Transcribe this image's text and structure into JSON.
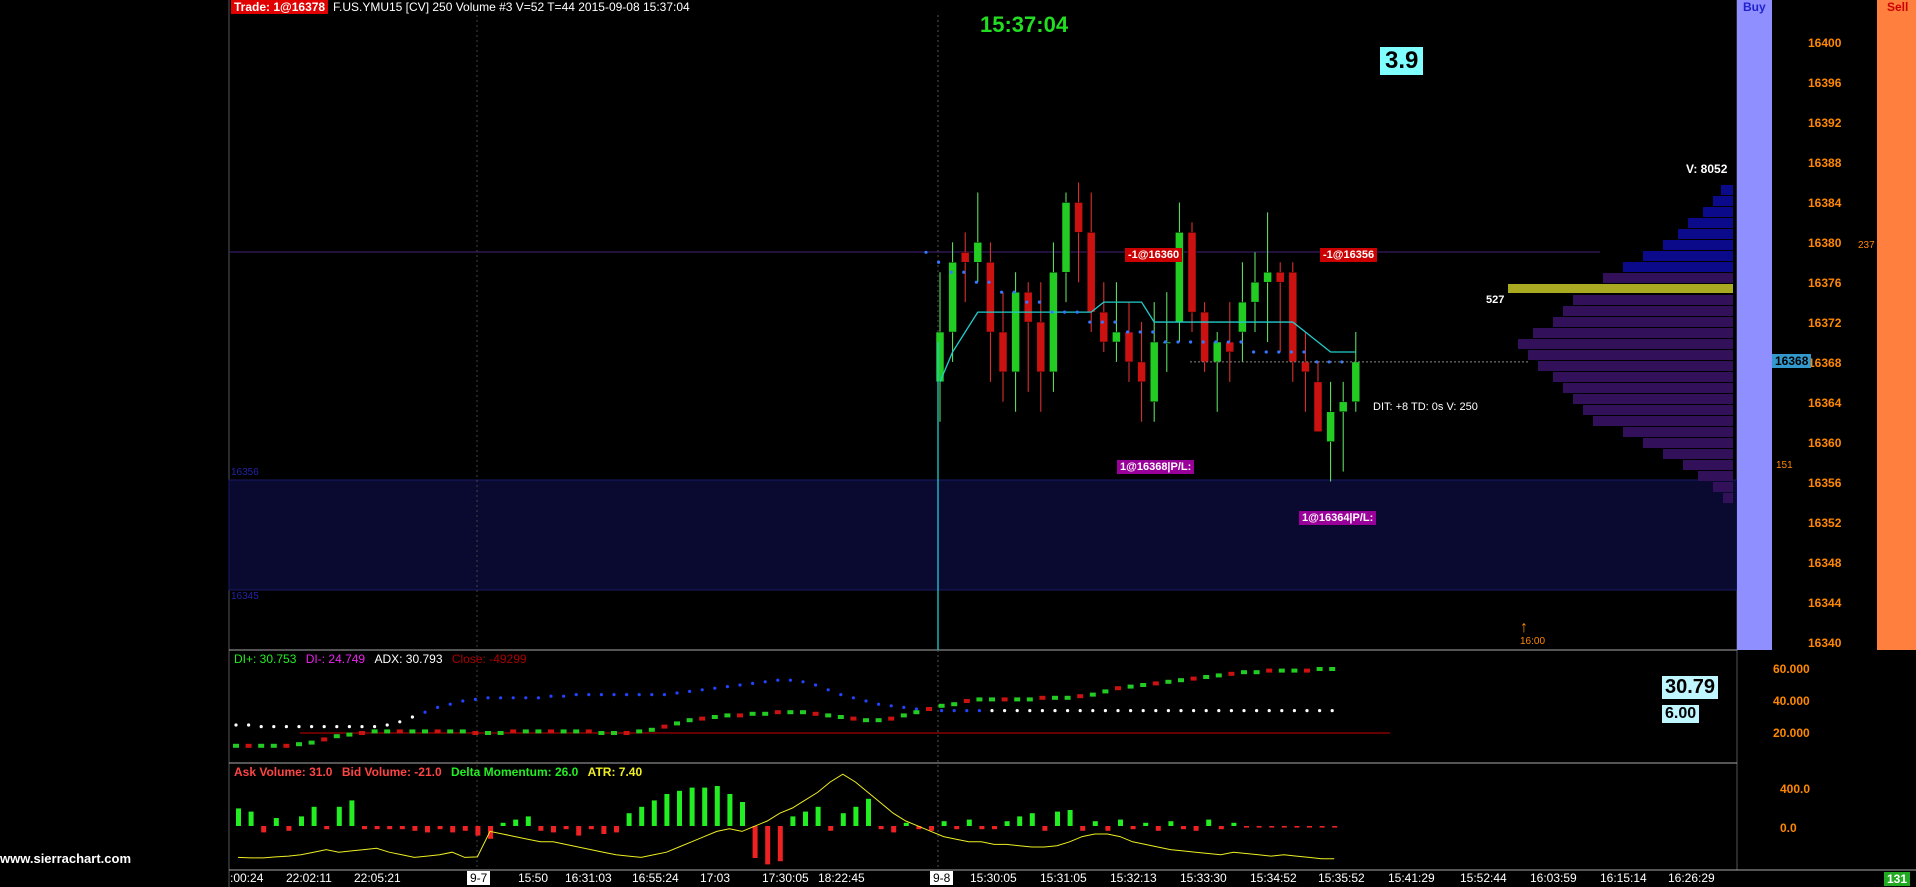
{
  "header": {
    "trade_badge": "Trade: 1@16378",
    "title": "F.US.YMU15 [CV]  250 Volume  #3 V=52 T=44 2015-09-08 15:37:04"
  },
  "clock": "15:37:04",
  "countdown_box": "3.9",
  "buy_label": "Buy",
  "sell_label": "Sell",
  "watermark": "www.sierrachart.com",
  "price_axis": [
    "16400",
    "16396",
    "16392",
    "16388",
    "16384",
    "16380",
    "16376",
    "16372",
    "16368",
    "16364",
    "16360",
    "16356",
    "16352",
    "16348",
    "16344",
    "16340"
  ],
  "current_price": "16368",
  "volume_profile": {
    "total_label": "V: 8052",
    "poc_volume": "527"
  },
  "orders": {
    "sell_1": "-1@16360",
    "sell_2": "-1@16356",
    "fill_1": "1@16368|P/L:",
    "fill_2": "1@16364|P/L:"
  },
  "bar_info": "DIT: +8  TD: 0s  V: 250",
  "zone_labels": {
    "upper": "16356",
    "lower": "16345"
  },
  "session_marker": "16:00",
  "side_numbers": {
    "top": "237",
    "bottom": "151"
  },
  "dmi_panel": {
    "di_plus": "DI+: 30.753",
    "di_minus": "DI-: 24.749",
    "adx": "ADX: 30.793",
    "close": "Close: -49299",
    "value_box_1": "30.79",
    "value_box_2": "6.00",
    "axis": [
      "60.000",
      "40.000",
      "20.000"
    ]
  },
  "volume_panel": {
    "ask": "Ask Volume: 31.0",
    "bid": "Bid Volume: -21.0",
    "delta": "Delta Momentum: 26.0",
    "atr": "ATR: 7.40",
    "axis": [
      "400.0",
      "0.0"
    ]
  },
  "time_axis": [
    {
      "label": ":00:24",
      "hl": false
    },
    {
      "label": "22:02:11",
      "hl": false
    },
    {
      "label": "22:05:21",
      "hl": false
    },
    {
      "label": "9-7",
      "hl": true
    },
    {
      "label": "15:50",
      "hl": false
    },
    {
      "label": "16:31:03",
      "hl": false
    },
    {
      "label": "16:55:24",
      "hl": false
    },
    {
      "label": "17:03",
      "hl": false
    },
    {
      "label": "17:30:05",
      "hl": false
    },
    {
      "label": "18:22:45",
      "hl": false
    },
    {
      "label": "9-8",
      "hl": true
    },
    {
      "label": "15:30:05",
      "hl": false
    },
    {
      "label": "15:31:05",
      "hl": false
    },
    {
      "label": "15:32:13",
      "hl": false
    },
    {
      "label": "15:33:30",
      "hl": false
    },
    {
      "label": "15:34:52",
      "hl": false
    },
    {
      "label": "15:35:52",
      "hl": false
    },
    {
      "label": "15:41:29",
      "hl": false
    },
    {
      "label": "15:52:44",
      "hl": false
    },
    {
      "label": "16:03:59",
      "hl": false
    },
    {
      "label": "16:15:14",
      "hl": false
    },
    {
      "label": "16:26:29",
      "hl": false
    }
  ],
  "corner_value": "131",
  "candles": [
    {
      "o": 16366,
      "h": 16377,
      "l": 16362,
      "c": 16371
    },
    {
      "o": 16371,
      "h": 16380,
      "l": 16368,
      "c": 16378
    },
    {
      "o": 16379,
      "h": 16381,
      "l": 16374,
      "c": 16378
    },
    {
      "o": 16378,
      "h": 16385,
      "l": 16376,
      "c": 16380
    },
    {
      "o": 16378,
      "h": 16380,
      "l": 16366,
      "c": 16371
    },
    {
      "o": 16371,
      "h": 16375,
      "l": 16364,
      "c": 16367
    },
    {
      "o": 16367,
      "h": 16377,
      "l": 16363,
      "c": 16375
    },
    {
      "o": 16375,
      "h": 16376,
      "l": 16365,
      "c": 16372
    },
    {
      "o": 16372,
      "h": 16376,
      "l": 16363,
      "c": 16367
    },
    {
      "o": 16367,
      "h": 16380,
      "l": 16365,
      "c": 16377
    },
    {
      "o": 16377,
      "h": 16385,
      "l": 16374,
      "c": 16384
    },
    {
      "o": 16384,
      "h": 16386,
      "l": 16376,
      "c": 16381
    },
    {
      "o": 16381,
      "h": 16385,
      "l": 16371,
      "c": 16373
    },
    {
      "o": 16373,
      "h": 16376,
      "l": 16369,
      "c": 16370
    },
    {
      "o": 16370,
      "h": 16376,
      "l": 16368,
      "c": 16371
    },
    {
      "o": 16371,
      "h": 16374,
      "l": 16366,
      "c": 16368
    },
    {
      "o": 16368,
      "h": 16372,
      "l": 16362,
      "c": 16366
    },
    {
      "o": 16364,
      "h": 16374,
      "l": 16362,
      "c": 16370
    },
    {
      "o": 16370,
      "h": 16375,
      "l": 16367,
      "c": 16370
    },
    {
      "o": 16372,
      "h": 16384,
      "l": 16370,
      "c": 16381
    },
    {
      "o": 16381,
      "h": 16382,
      "l": 16371,
      "c": 16373
    },
    {
      "o": 16373,
      "h": 16374,
      "l": 16367,
      "c": 16368
    },
    {
      "o": 16368,
      "h": 16371,
      "l": 16363,
      "c": 16370
    },
    {
      "o": 16370,
      "h": 16374,
      "l": 16366,
      "c": 16369
    },
    {
      "o": 16371,
      "h": 16378,
      "l": 16368,
      "c": 16374
    },
    {
      "o": 16374,
      "h": 16379,
      "l": 16371,
      "c": 16376
    },
    {
      "o": 16376,
      "h": 16383,
      "l": 16370,
      "c": 16377
    },
    {
      "o": 16377,
      "h": 16378,
      "l": 16369,
      "c": 16376
    },
    {
      "o": 16377,
      "h": 16378,
      "l": 16366,
      "c": 16368
    },
    {
      "o": 16368,
      "h": 16371,
      "l": 16363,
      "c": 16367
    },
    {
      "o": 16366,
      "h": 16368,
      "l": 16361,
      "c": 16361
    },
    {
      "o": 16360,
      "h": 16366,
      "l": 16356,
      "c": 16363
    },
    {
      "o": 16363,
      "h": 16366,
      "l": 16357,
      "c": 16364
    },
    {
      "o": 16364,
      "h": 16371,
      "l": 16363,
      "c": 16368
    }
  ],
  "ema_line": [
    16366,
    16369,
    16371,
    16373,
    16373,
    16373,
    16373,
    16373,
    16373,
    16373,
    16373,
    16373,
    16373,
    16374,
    16374,
    16374,
    16374,
    16372,
    16372,
    16372,
    16372,
    16372,
    16372,
    16372,
    16372,
    16372,
    16372,
    16372,
    16372,
    16371,
    16370,
    16369,
    16369,
    16369
  ],
  "dot_line": [
    16379,
    16378,
    16377,
    16377,
    16376,
    16376,
    16375,
    16375,
    16374,
    16374,
    16373,
    16373,
    16373,
    16372,
    16372,
    16372,
    16371,
    16371,
    16371,
    16370,
    16370,
    16370,
    16370,
    16370,
    16370,
    16370,
    16369,
    16369,
    16369,
    16369,
    16369,
    16368,
    16368,
    16368
  ],
  "dmi_adx": [
    25,
    25,
    24,
    24,
    24,
    24,
    24,
    24,
    24,
    24,
    24,
    24,
    25,
    27,
    30,
    33,
    36,
    38,
    40,
    41,
    42,
    42,
    42,
    42,
    42,
    43,
    43,
    44,
    44,
    44,
    44,
    44,
    44,
    44,
    44,
    45,
    46,
    47,
    48,
    49,
    50,
    51,
    52,
    53,
    53,
    52,
    50,
    47,
    44,
    42,
    40,
    38,
    37,
    36,
    35,
    35,
    34,
    34,
    34,
    34,
    34,
    34,
    34,
    34,
    34,
    34,
    34,
    34,
    34,
    34,
    34,
    34,
    34,
    34,
    34,
    34,
    34,
    34,
    34,
    34,
    34,
    34,
    34,
    34,
    34,
    34,
    34,
    34
  ],
  "dmi_plus": [
    12,
    12,
    12,
    12,
    12,
    13,
    14,
    16,
    18,
    19,
    20,
    21,
    21,
    21,
    21,
    21,
    21,
    21,
    21,
    20,
    20,
    20,
    21,
    21,
    21,
    21,
    21,
    21,
    21,
    20,
    20,
    20,
    21,
    22,
    24,
    26,
    28,
    29,
    30,
    31,
    31,
    32,
    32,
    33,
    33,
    33,
    32,
    31,
    30,
    29,
    28,
    28,
    29,
    31,
    33,
    35,
    37,
    38,
    40,
    41,
    41,
    41,
    41,
    41,
    42,
    42,
    42,
    43,
    44,
    46,
    48,
    49,
    50,
    51,
    52,
    53,
    54,
    55,
    56,
    57,
    58,
    58,
    59,
    59,
    59,
    59,
    60,
    60
  ],
  "vol_ask": [
    110,
    90,
    0,
    50,
    0,
    60,
    120,
    0,
    120,
    160,
    0,
    0,
    0,
    0,
    0,
    0,
    0,
    0,
    0,
    0,
    0,
    20,
    40,
    60,
    0,
    0,
    0,
    0,
    0,
    0,
    0,
    80,
    120,
    160,
    200,
    220,
    240,
    240,
    250,
    200,
    150,
    0,
    0,
    0,
    60,
    90,
    120,
    0,
    80,
    120,
    170,
    0,
    0,
    20,
    0,
    0,
    30,
    0,
    40,
    0,
    0,
    30,
    60,
    80,
    0,
    90,
    100,
    0,
    30,
    0,
    40,
    0,
    20,
    0,
    30,
    0,
    0,
    40,
    0,
    20,
    0,
    0,
    0,
    0,
    0,
    0,
    0,
    0
  ],
  "vol_bid": [
    0,
    0,
    -40,
    0,
    -30,
    0,
    0,
    -20,
    0,
    0,
    -20,
    -20,
    -20,
    -20,
    -30,
    -40,
    -20,
    -40,
    -30,
    -60,
    -80,
    0,
    0,
    0,
    -30,
    -40,
    -20,
    -60,
    -20,
    -50,
    -40,
    0,
    0,
    0,
    0,
    0,
    0,
    0,
    0,
    0,
    0,
    -200,
    -240,
    -220,
    0,
    0,
    0,
    -30,
    0,
    0,
    0,
    -20,
    -40,
    0,
    -20,
    -30,
    0,
    -20,
    0,
    -20,
    -20,
    0,
    0,
    0,
    -30,
    0,
    0,
    -30,
    0,
    -30,
    0,
    -20,
    0,
    -30,
    0,
    -20,
    -30,
    0,
    -20,
    0,
    -10,
    -10,
    -10,
    -10,
    -10,
    -10,
    -10,
    -10
  ],
  "vol_atr": [
    10,
    8,
    8,
    12,
    15,
    20,
    30,
    40,
    30,
    35,
    40,
    45,
    30,
    20,
    10,
    15,
    20,
    30,
    10,
    12,
    110,
    100,
    90,
    80,
    70,
    70,
    60,
    50,
    40,
    30,
    20,
    15,
    10,
    20,
    30,
    50,
    70,
    90,
    110,
    120,
    110,
    130,
    150,
    180,
    200,
    230,
    260,
    300,
    330,
    300,
    260,
    220,
    180,
    150,
    130,
    110,
    90,
    80,
    70,
    70,
    60,
    60,
    55,
    50,
    50,
    55,
    70,
    90,
    100,
    100,
    90,
    70,
    60,
    50,
    40,
    35,
    30,
    25,
    20,
    30,
    25,
    20,
    15,
    20,
    15,
    10,
    5,
    5
  ]
}
